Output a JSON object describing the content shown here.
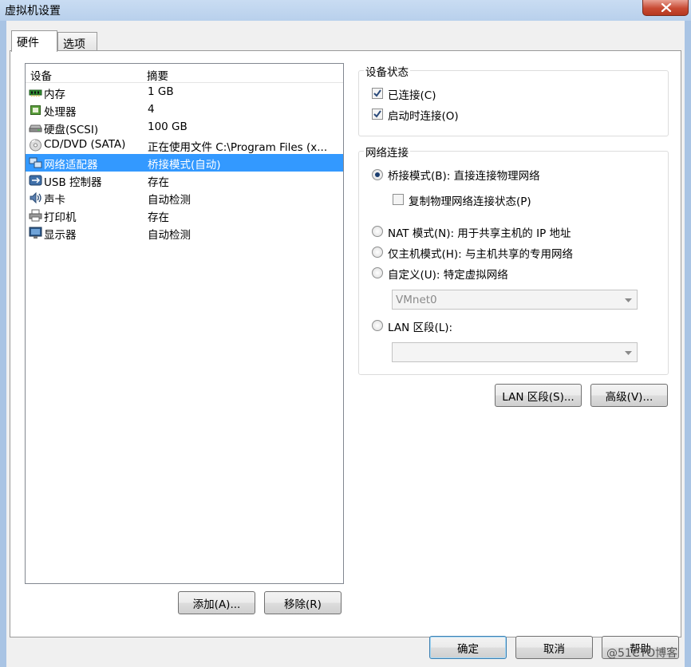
{
  "window": {
    "title": "虚拟机设置"
  },
  "tabs": [
    {
      "label": "硬件"
    },
    {
      "label": "选项"
    }
  ],
  "device_list": {
    "headers": {
      "device": "设备",
      "summary": "摘要"
    },
    "rows": [
      {
        "name": "内存",
        "summary": "1 GB",
        "icon": "memory-icon"
      },
      {
        "name": "处理器",
        "summary": "4",
        "icon": "processor-icon"
      },
      {
        "name": "硬盘(SCSI)",
        "summary": "100 GB",
        "icon": "hard-disk-icon"
      },
      {
        "name": "CD/DVD (SATA)",
        "summary": "正在使用文件 C:\\Program Files (x...",
        "icon": "cd-dvd-icon"
      },
      {
        "name": "网络适配器",
        "summary": "桥接模式(自动)",
        "icon": "network-adapter-icon",
        "selected": true
      },
      {
        "name": "USB 控制器",
        "summary": "存在",
        "icon": "usb-icon"
      },
      {
        "name": "声卡",
        "summary": "自动检测",
        "icon": "sound-card-icon"
      },
      {
        "name": "打印机",
        "summary": "存在",
        "icon": "printer-icon"
      },
      {
        "name": "显示器",
        "summary": "自动检测",
        "icon": "display-icon"
      }
    ]
  },
  "list_buttons": {
    "add": "添加(A)...",
    "remove": "移除(R)"
  },
  "device_status": {
    "title": "设备状态",
    "connected": {
      "label": "已连接(C)",
      "checked": true
    },
    "connect_at_power_on": {
      "label": "启动时连接(O)",
      "checked": true
    }
  },
  "network": {
    "title": "网络连接",
    "bridged": {
      "label": "桥接模式(B): 直接连接物理网络",
      "selected": true
    },
    "replicate": {
      "label": "复制物理网络连接状态(P)",
      "checked": false
    },
    "nat": {
      "label": "NAT 模式(N): 用于共享主机的 IP 地址",
      "selected": false
    },
    "host_only": {
      "label": "仅主机模式(H): 与主机共享的专用网络",
      "selected": false
    },
    "custom": {
      "label": "自定义(U): 特定虚拟网络",
      "selected": false
    },
    "vmnet_value": "VMnet0",
    "lan_segment": {
      "label": "LAN 区段(L):",
      "selected": false
    },
    "lan_segment_value": ""
  },
  "network_buttons": {
    "lan_segments": "LAN 区段(S)...",
    "advanced": "高级(V)..."
  },
  "footer": {
    "ok": "确定",
    "cancel": "取消",
    "help": "帮助"
  },
  "watermark": "@51CTO博客",
  "colors": {
    "selection": "#3399ff",
    "title_bar": "#c9dcf2",
    "close_button": "#c84a33"
  }
}
